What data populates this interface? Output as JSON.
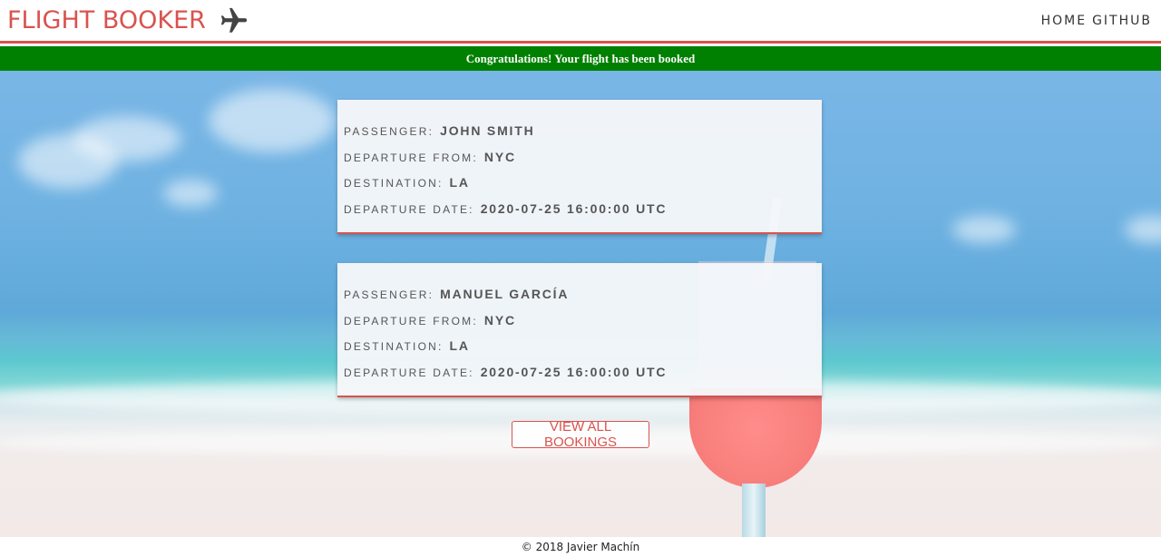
{
  "header": {
    "brand": "FLIGHT BOOKER",
    "brand_icon": "airplane-icon",
    "nav": [
      {
        "label": "HOME"
      },
      {
        "label": "GITHUB"
      }
    ]
  },
  "banner": {
    "message": "Congratulations! Your flight has been booked",
    "color": "#008000"
  },
  "labels": {
    "passenger": "PASSENGER:",
    "departure_from": "DEPARTURE FROM:",
    "destination": "DESTINATION:",
    "departure_date": "DEPARTURE DATE:"
  },
  "bookings": [
    {
      "passenger": "JOHN SMITH",
      "departure_from": "NYC",
      "destination": "LA",
      "departure_date": "2020-07-25 16:00:00 UTC"
    },
    {
      "passenger": "MANUEL GARCÍA",
      "departure_from": "NYC",
      "destination": "LA",
      "departure_date": "2020-07-25 16:00:00 UTC"
    }
  ],
  "actions": {
    "view_all": "VIEW ALL BOOKINGS"
  },
  "footer": {
    "copyright": "© 2018 Javier Machín"
  },
  "colors": {
    "accent": "#d9534f",
    "banner": "#008000"
  }
}
